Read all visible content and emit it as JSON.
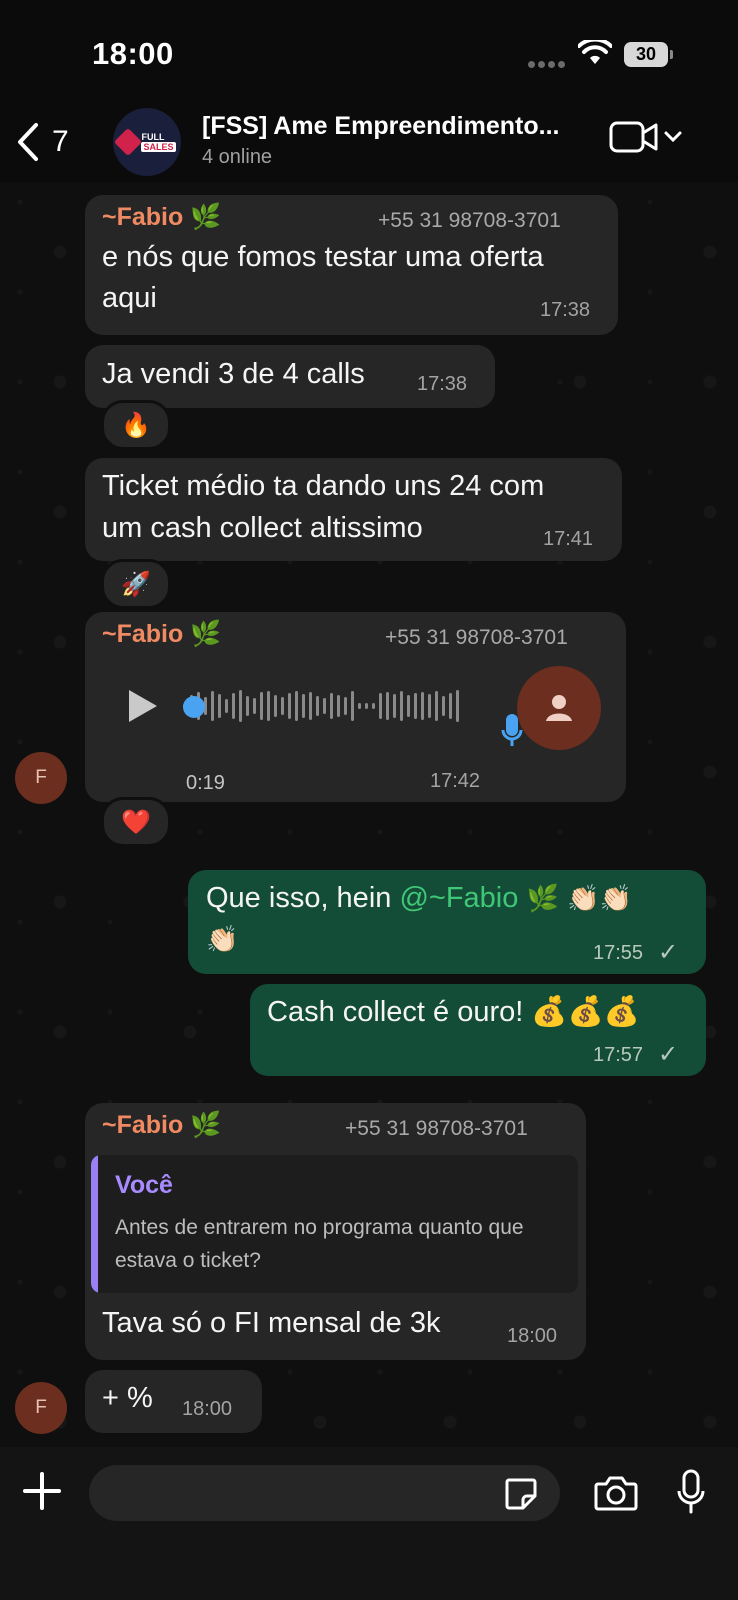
{
  "status_bar": {
    "time": "18:00",
    "battery": "30"
  },
  "header": {
    "back_count": "7",
    "group_name": "[FSS] Ame Empreendimento...",
    "online": "4 online",
    "logo_line1": "FULL",
    "logo_line2": "SALES"
  },
  "messages": {
    "m1": {
      "sender": "~Fabio 🌿",
      "phone": "+55 31 98708-3701",
      "line1": "e nós que fomos testar uma oferta",
      "line2": "aqui",
      "time": "17:38"
    },
    "m2": {
      "text": "Ja vendi 3 de 4 calls",
      "time": "17:38",
      "reaction": "🔥"
    },
    "m3": {
      "line1": "Ticket médio ta dando uns 24 com",
      "line2": "um cash collect altissimo",
      "time": "17:41",
      "reaction": "🚀"
    },
    "m4": {
      "sender": "~Fabio 🌿",
      "phone": "+55 31 98708-3701",
      "duration": "0:19",
      "time": "17:42",
      "reaction": "❤️",
      "avatar_letter": "F"
    },
    "m5": {
      "prefix": "Que isso, hein ",
      "mention": "@~Fabio",
      "emoji_line1": "🌿 👏🏻👏🏻",
      "emoji_line2": "👏🏻",
      "time": "17:55",
      "tick": "✓"
    },
    "m6": {
      "text": "Cash collect é ouro! 💰💰💰",
      "time": "17:57",
      "tick": "✓"
    },
    "m7": {
      "sender": "~Fabio 🌿",
      "phone": "+55 31 98708-3701",
      "quote_author": "Você",
      "quote_text": "Antes de entrarem no programa quanto que estava o ticket?",
      "text": "Tava só o FI mensal de 3k",
      "time": "18:00"
    },
    "m8": {
      "text": "+ %",
      "time": "18:00",
      "avatar_letter": "F"
    }
  },
  "input": {
    "placeholder": "",
    "value": ""
  },
  "colors": {
    "incoming_bubble": "#262626",
    "outgoing_bubble": "#144d37",
    "sender_name": "#f08a63",
    "mention": "#3fc777",
    "quote_author": "#a88bff"
  }
}
